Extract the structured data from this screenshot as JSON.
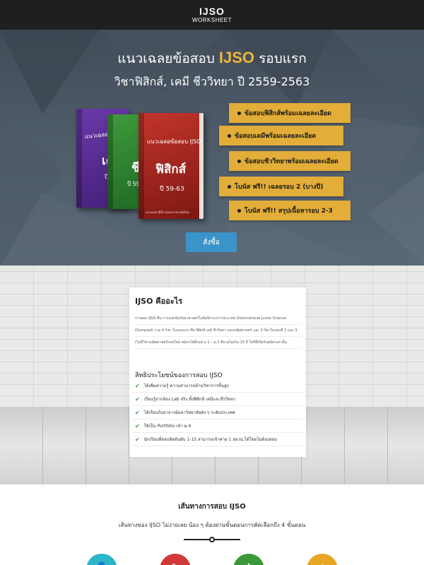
{
  "header": {
    "logo_main": "IJSO",
    "logo_sub": "WORKSHEET"
  },
  "hero": {
    "title_pre": "แนวเฉลยข้อสอบ ",
    "title_accent": "IJSO",
    "title_post": " รอบแรก",
    "subtitle": "วิชาฟิสิกส์, เคมี ชีววิทยา ปี 2559-2563",
    "books": {
      "purple": {
        "series": "แนวเฉลยข้อสอบ",
        "subject": "เค",
        "year": "ปี 59"
      },
      "green": {
        "subject": "ชี",
        "year": "ปี 59"
      },
      "red": {
        "series": "แนวเฉลยข้อสอบ IJSO",
        "subject": "ฟิสิกส์",
        "year": "ปี 59-63",
        "footer": "แนวเฉลย IJSO รอบแรกประเทศไทย"
      }
    },
    "ribbons": [
      "ข้อสอบฟิสิกส์พร้อมเฉลยละเอียด",
      "ข้อสอบเคมีพร้อมเฉลยละเอียด",
      "ข้อสอบชีววิทยาพร้อมเฉลยละเอียด",
      "โบนัส ฟรี!! เฉลยรอบ 2 (บางปี)",
      "โบนัส ฟรี!! สรุปเนื้อหารอบ 2-3"
    ],
    "order_label": "สั่งซื้อ",
    "accent_color": "#f0b53b",
    "ribbon_color": "#e2ad38",
    "button_color": "#3a93c9"
  },
  "about": {
    "title": "IJSO คืออะไร",
    "paragraph": "การสอบ IJSO คือ การแข่งขันวิทยาศาสตร์โอลิมปิกระหว่างประเทศ (International Junior Science Olympiad) รวม 4 วิชา ในรอบแรก คือ ฟิสิกส์ เคมี ชีววิทยา และคณิตศาสตร์ และ 3 วิชาในรอบที่ 2 และ 3 (ไม่มีวิชาคณิตศาสตร์รอบใหม่ สมัครได้ตั้งแต่ ม.1 – ม.3 ที่อายุไม่เกิน 15 ปี ในปีที่เปิดรับสมัครเท่านั้น",
    "benefits_title": "สิทธิประโยชน์ของการสอบ IJSO",
    "benefits": [
      "ได้เพิ่มความรู้ ความสามารถด้านวิชาการขั้นสูง",
      "เรียนรู้จากห้อง Lab จริง ทั้งฟิสิกส์ เคมีและชีววิทยา",
      "ได้เรียนกับอาจารย์มหาวิทยาลัยดัง ๆ ระดับประเทศ",
      "ใช้เป็น Portfolio เข้า ม.4",
      "นักเรียนที่สอบติดอันดับ 1-15 สามารถเข้าค่าย 1 สอวน.ได้โดยไม่ต้องสอบ"
    ]
  },
  "path": {
    "title": "เส้นทางการสอบ IJSO",
    "subtitle": "เส้นทางของ IJSO ไม่ง่ายเลย น้อง ๆ ต้องผ่านขั้นตอนการคัดเลือกถึง 4 ขั้นตอน",
    "steps": [
      {
        "color": "#2bb6c9",
        "icon": "person-icon"
      },
      {
        "color": "#d23a3a",
        "icon": "document-icon"
      },
      {
        "color": "#3a9a3a",
        "icon": "star-icon"
      },
      {
        "color": "#e6a623",
        "icon": "trophy-icon"
      }
    ]
  }
}
